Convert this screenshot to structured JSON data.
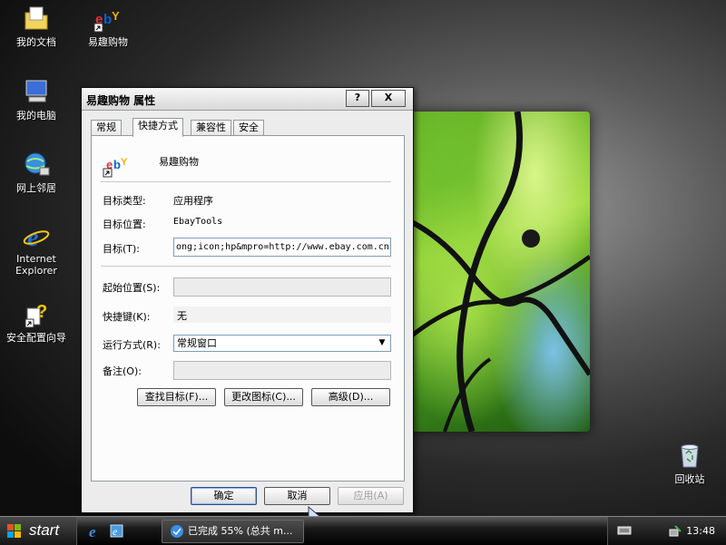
{
  "desktop": {
    "icons": [
      {
        "label": "我的文档"
      },
      {
        "label": "易趣购物"
      },
      {
        "label": "我的电脑"
      },
      {
        "label": "网上邻居"
      },
      {
        "label": "Internet Explorer"
      },
      {
        "label": "安全配置向导"
      },
      {
        "label": "回收站"
      }
    ]
  },
  "dialog": {
    "title": "易趣购物 属性",
    "help_label": "?",
    "close_label": "X",
    "tabs": [
      {
        "label": "常规"
      },
      {
        "label": "快捷方式"
      },
      {
        "label": "兼容性"
      },
      {
        "label": "安全"
      }
    ],
    "shortcut_name": "易趣购物",
    "target_type_label": "目标类型:",
    "target_type_value": "应用程序",
    "target_location_label": "目标位置:",
    "target_location_value": "EbayTools",
    "target_label": "目标(T):",
    "target_value": "ong;icon;hp&mpro=http://www.ebay.com.cn",
    "start_in_label": "起始位置(S):",
    "start_in_value": "",
    "hotkey_label": "快捷键(K):",
    "hotkey_value": "无",
    "run_label": "运行方式(R):",
    "run_value": "常规窗口",
    "comment_label": "备注(O):",
    "comment_value": "",
    "find_target_button": "查找目标(F)...",
    "change_icon_button": "更改图标(C)...",
    "advanced_button": "高级(D)...",
    "ok_button": "确定",
    "cancel_button": "取消",
    "apply_button": "应用(A)"
  },
  "taskbar": {
    "start_label": "start",
    "task_label": "已完成 55% (总共 m...",
    "clock": "13:48"
  },
  "colors": {
    "dialog_bg": "#ececec",
    "taskbar_bg": "#1a1a1a",
    "ie_blue": "#1e73d2",
    "ebay_red": "#e53238"
  }
}
